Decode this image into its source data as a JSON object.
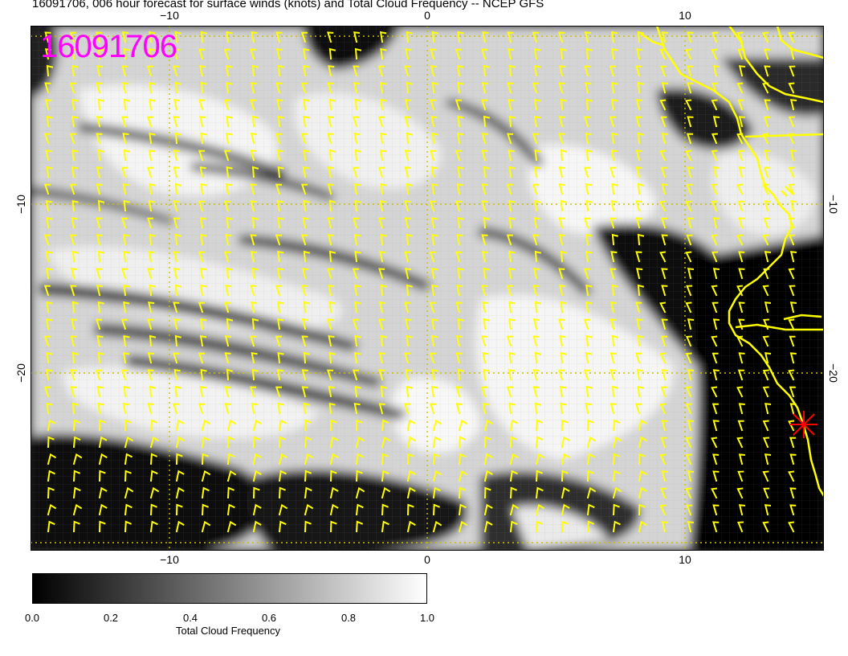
{
  "title": "16091706, 006 hour forecast for surface winds (knots) and Total Cloud Frequency -- NCEP GFS",
  "stamp": "16091706",
  "axes": {
    "lon_top": [
      "−10",
      "0",
      "10"
    ],
    "lon_bottom": [
      "−10",
      "0",
      "10"
    ],
    "lat_left": [
      "−10",
      "−20"
    ],
    "lat_right": [
      "−10",
      "−20"
    ]
  },
  "colorbar": {
    "label": "Total Cloud Frequency",
    "ticks": [
      "0.0",
      "0.2",
      "0.4",
      "0.6",
      "0.8",
      "1.0"
    ],
    "min_color": "#000000",
    "max_color": "#ffffff"
  },
  "colors": {
    "wind_barbs": "#ffff00",
    "coastline": "#ffff00",
    "stamp": "#ff00ff",
    "marker": "#ff0000"
  }
}
